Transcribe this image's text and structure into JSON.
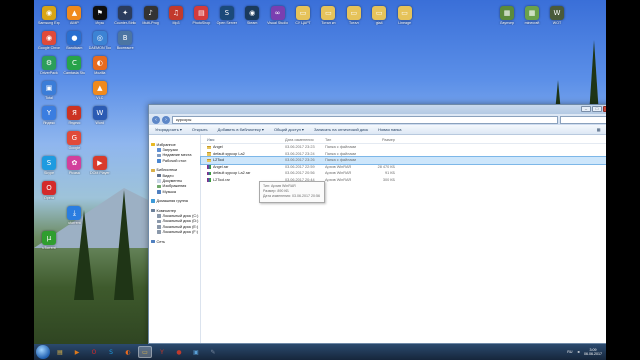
{
  "desktop_icons": [
    {
      "label": "Samsung Experience",
      "icon": "chrome-icon",
      "color": "#d9a514",
      "glyph": "◉",
      "col": 0,
      "row": 0
    },
    {
      "label": "Google Chrome",
      "icon": "chrome-icon",
      "color": "#e04a3a",
      "glyph": "◉",
      "col": 0,
      "row": 1
    },
    {
      "label": "DriverPack",
      "icon": "gear-icon",
      "color": "#2c9e5a",
      "glyph": "⚙",
      "col": 0,
      "row": 2
    },
    {
      "label": "Total",
      "icon": "folder-icon",
      "color": "#3b7dd8",
      "glyph": "▣",
      "col": 0,
      "row": 3
    },
    {
      "label": "Яндекс",
      "icon": "yandex-icon",
      "color": "#3a7de0",
      "glyph": "Y",
      "col": 0,
      "row": 4
    },
    {
      "label": "Skype",
      "icon": "skype-icon",
      "color": "#1e9be0",
      "glyph": "S",
      "col": 0,
      "row": 6
    },
    {
      "label": "Opera",
      "icon": "opera-icon",
      "color": "#d42a2a",
      "glyph": "O",
      "col": 0,
      "row": 7
    },
    {
      "label": "uTorrent",
      "icon": "torrent-icon",
      "color": "#2f9e2f",
      "glyph": "µ",
      "col": 0,
      "row": 9
    },
    {
      "label": "AIMP",
      "icon": "aimp-icon",
      "color": "#f08a1c",
      "glyph": "▲",
      "col": 1,
      "row": 0
    },
    {
      "label": "Bandicam",
      "icon": "camera-icon",
      "color": "#2a6fd0",
      "glyph": "●",
      "col": 1,
      "row": 1
    },
    {
      "label": "Camtasia Studio",
      "icon": "video-icon",
      "color": "#27a34a",
      "glyph": "C",
      "col": 1,
      "row": 2
    },
    {
      "label": "Яндекс",
      "icon": "yandex-icon",
      "color": "#cc3322",
      "glyph": "Я",
      "col": 1,
      "row": 4
    },
    {
      "label": "Google",
      "icon": "google-icon",
      "color": "#e04a3a",
      "glyph": "G",
      "col": 1,
      "row": 5
    },
    {
      "label": "Picasa",
      "icon": "photo-icon",
      "color": "#d2409c",
      "glyph": "✿",
      "col": 1,
      "row": 6
    },
    {
      "label": "utorrent",
      "icon": "arrow-icon",
      "color": "#2a7de0",
      "glyph": "⤓",
      "col": 1,
      "row": 8
    },
    {
      "label": "Игры",
      "icon": "game-icon",
      "color": "#0e0e0e",
      "glyph": "⚑",
      "col": 2,
      "row": 0
    },
    {
      "label": "DAEMON Tools",
      "icon": "disk-icon",
      "color": "#3c83d4",
      "glyph": "◎",
      "col": 2,
      "row": 1
    },
    {
      "label": "Mozilla",
      "icon": "firefox-icon",
      "color": "#e86b1f",
      "glyph": "◐",
      "col": 2,
      "row": 2
    },
    {
      "label": "VLC",
      "icon": "vlc-icon",
      "color": "#f08a1c",
      "glyph": "▲",
      "col": 2,
      "row": 3
    },
    {
      "label": "Word",
      "icon": "word-icon",
      "color": "#2b5bb3",
      "glyph": "W",
      "col": 2,
      "row": 4
    },
    {
      "label": "DOM Player",
      "icon": "player-icon",
      "color": "#d83b2c",
      "glyph": "▶",
      "col": 2,
      "row": 6
    },
    {
      "label": "Counter-Strike",
      "icon": "cs-icon",
      "color": "#2b3c5e",
      "glyph": "✦",
      "col": 3,
      "row": 0
    },
    {
      "label": "Вконтакте",
      "icon": "vk-icon",
      "color": "#4c75a3",
      "glyph": "В",
      "col": 3,
      "row": 1
    },
    {
      "label": "Multi-Prog",
      "icon": "audio-icon",
      "color": "#333333",
      "glyph": "♪",
      "col": 4,
      "row": 0
    },
    {
      "label": "Mp3",
      "icon": "mp3-icon",
      "color": "#c23a2c",
      "glyph": "♫",
      "col": 5,
      "row": 0
    },
    {
      "label": "PhotoShop",
      "icon": "pdf-icon",
      "color": "#d43b3b",
      "glyph": "▤",
      "col": 6,
      "row": 0
    },
    {
      "label": "Open Server",
      "icon": "steam-icon",
      "color": "#1b4a7a",
      "glyph": "S",
      "col": 7,
      "row": 0
    },
    {
      "label": "Steam",
      "icon": "steam-icon",
      "color": "#1a3a5c",
      "glyph": "◉",
      "col": 8,
      "row": 0
    },
    {
      "label": "Visual Studio",
      "icon": "vs-icon",
      "color": "#7a3fb0",
      "glyph": "∞",
      "col": 9,
      "row": 0
    },
    {
      "label": "СУ ЦАРТ",
      "icon": "folder-icon",
      "color": "#e6c35a",
      "glyph": "▭",
      "col": 10,
      "row": 0
    },
    {
      "label": "Тотал кн",
      "icon": "folder-icon",
      "color": "#e6c35a",
      "glyph": "▭",
      "col": 11,
      "row": 0
    },
    {
      "label": "Тотал",
      "icon": "folder-icon",
      "color": "#e6c35a",
      "glyph": "▭",
      "col": 12,
      "row": 0
    },
    {
      "label": "gta4",
      "icon": "folder-icon",
      "color": "#e6c35a",
      "glyph": "▭",
      "col": 13,
      "row": 0
    },
    {
      "label": "Lineage",
      "icon": "folder-icon",
      "color": "#e6c35a",
      "glyph": "▭",
      "col": 14,
      "row": 0
    }
  ],
  "desktop_right_icons": [
    {
      "label": "Лаунчер",
      "icon": "minecraft-icon",
      "color": "#5b8a3a",
      "glyph": "▦",
      "col": 0
    },
    {
      "label": "minecraft",
      "icon": "minecraft-icon",
      "color": "#6aa14a",
      "glyph": "▦",
      "col": 1
    },
    {
      "label": "WOT",
      "icon": "wot-icon",
      "color": "#4a5a3a",
      "glyph": "W",
      "col": 2
    }
  ],
  "explorer": {
    "address": "курсоры",
    "toolbar": {
      "organize": "Упорядочить ▾",
      "open": "Открыть",
      "add_library": "Добавить в библиотеку ▾",
      "share": "Общий доступ ▾",
      "burn": "Записать на оптический диск",
      "new_folder": "Новая папка"
    },
    "nav": {
      "favorites": "Избранное",
      "downloads": "Загрузки",
      "recent": "Недавние места",
      "desktop": "Рабочий стол",
      "libraries": "Библиотеки",
      "videos": "Видео",
      "documents": "Документы",
      "pictures": "Изображения",
      "music": "Музыка",
      "homegroup": "Домашняя группа",
      "computer": "Компьютер",
      "disk1": "Локальный диск (C:)",
      "disk2": "Локальный диск (D:)",
      "disk3": "Локальный диск (E:)",
      "disk4": "Локальный диск (F:)",
      "network": "Сеть"
    },
    "columns": {
      "name": "Имя",
      "date": "Дата изменения",
      "type": "Тип",
      "size": "Размер"
    },
    "files": [
      {
        "name": "Angel",
        "date": "03.06.2017 23:23",
        "type": "Папка с файлами",
        "size": "",
        "kind": "folder"
      },
      {
        "name": "default курсор La2",
        "date": "03.06.2017 23:24",
        "type": "Папка с файлами",
        "size": "",
        "kind": "folder"
      },
      {
        "name": "L2Tool",
        "date": "03.06.2017 23:26",
        "type": "Папка с файлами",
        "size": "",
        "kind": "folder"
      },
      {
        "name": "Angel.rar",
        "date": "03.06.2017 22:59",
        "type": "Архив WinRAR",
        "size": "28 470 КБ",
        "kind": "rar"
      },
      {
        "name": "default курсор La2.rar",
        "date": "03.06.2017 20:56",
        "type": "Архив WinRAR",
        "size": "91 КБ",
        "kind": "rar"
      },
      {
        "name": "L2Tool.rar",
        "date": "03.06.2017 20:44",
        "type": "Архив WinRAR",
        "size": "300 КБ",
        "kind": "rar"
      }
    ],
    "tooltip": {
      "line1": "Тип: Архив WinRAR",
      "line2": "Размер: 890 КБ",
      "line3": "Дата изменения: 03.06.2017 20:56"
    }
  },
  "taskbar": {
    "apps": [
      {
        "icon": "explorer-icon",
        "glyph": "▤",
        "color": "#e2b84a",
        "active": false
      },
      {
        "icon": "mediaplayer-icon",
        "glyph": "▶",
        "color": "#e07a1c",
        "active": false
      },
      {
        "icon": "opera-icon",
        "glyph": "O",
        "color": "#d42a2a",
        "active": false
      },
      {
        "icon": "skype-icon",
        "glyph": "S",
        "color": "#1e9be0",
        "active": false
      },
      {
        "icon": "firefox-icon",
        "glyph": "◐",
        "color": "#e86b1f",
        "active": false
      },
      {
        "icon": "folder-icon",
        "glyph": "▭",
        "color": "#e2b84a",
        "active": true
      },
      {
        "icon": "yandex-icon",
        "glyph": "Y",
        "color": "#cc3322",
        "active": false
      },
      {
        "icon": "record-icon",
        "glyph": "●",
        "color": "#c23a2c",
        "active": false
      },
      {
        "icon": "image-icon",
        "glyph": "▣",
        "color": "#5aa0d8",
        "active": false
      },
      {
        "icon": "tool-icon",
        "glyph": "✎",
        "color": "#7a8aa0",
        "active": false
      }
    ],
    "language": "RU",
    "time": "3:09",
    "date": "06.06.2017"
  }
}
